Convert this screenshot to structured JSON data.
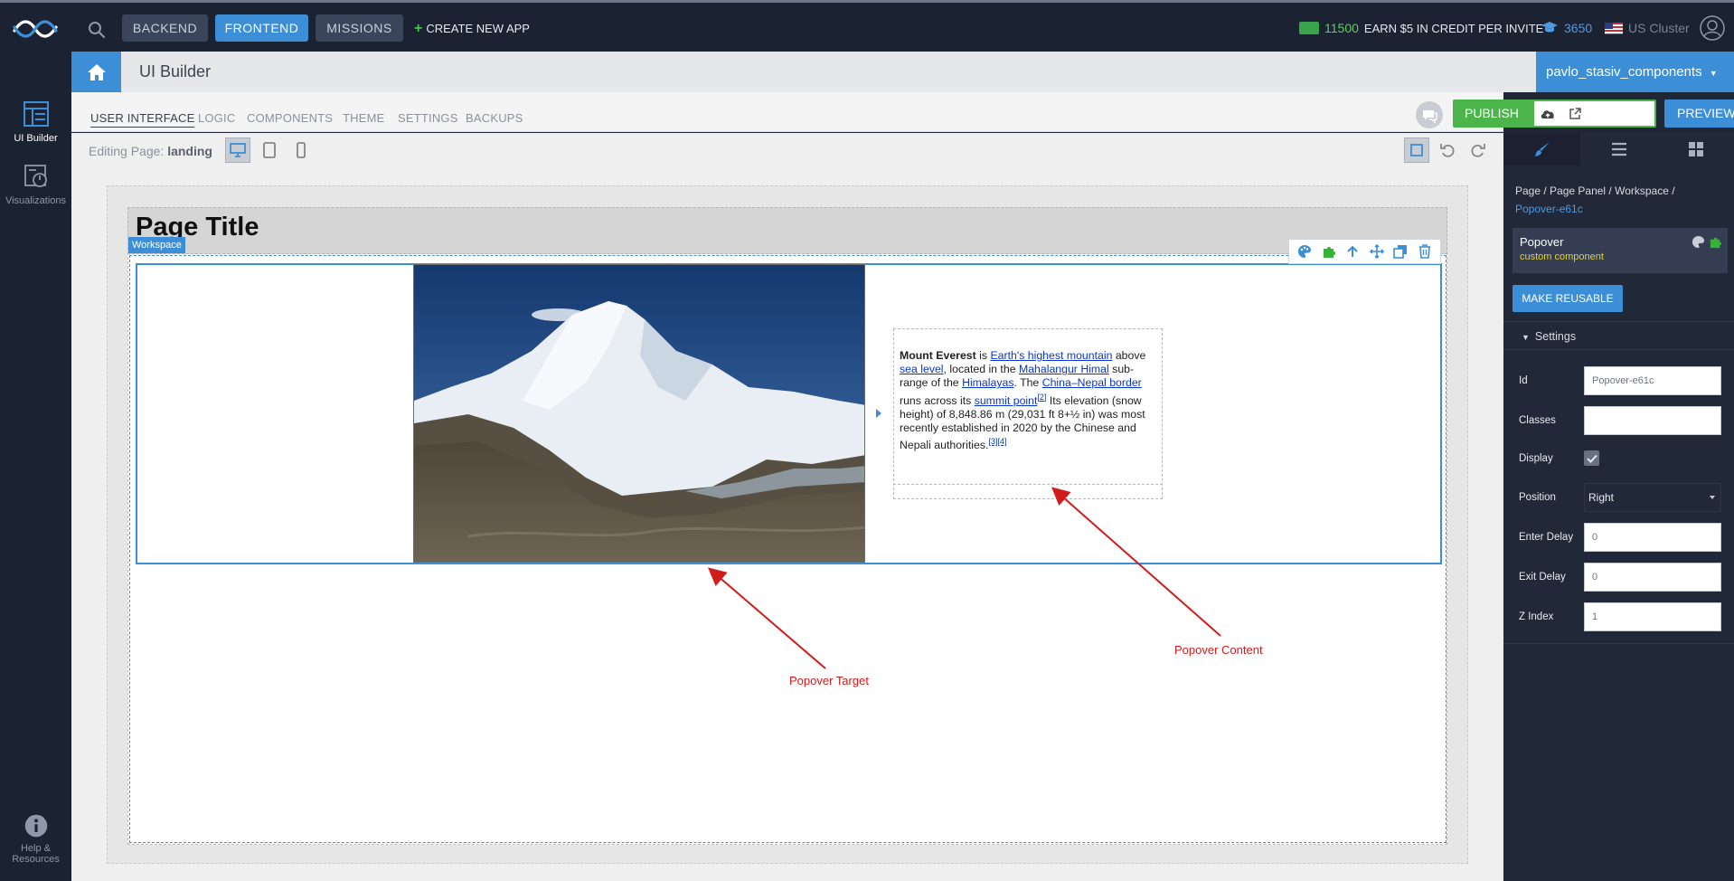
{
  "topbar": {
    "nav": [
      "BACKEND",
      "FRONTEND",
      "MISSIONS"
    ],
    "active_nav": "FRONTEND",
    "create_app": "CREATE NEW APP",
    "credits_value": "11500",
    "credits_text": "EARN $5 IN CREDIT PER INVITE",
    "education_value": "3650",
    "cluster": "US Cluster"
  },
  "left_sidebar": {
    "items": [
      {
        "label": "UI Builder",
        "icon": "ui-builder-icon"
      },
      {
        "label": "Visualizations",
        "icon": "visualizations-icon"
      }
    ],
    "help_line1": "Help &",
    "help_line2": "Resources"
  },
  "header": {
    "title": "UI Builder",
    "app_name": "pavlo_stasiv_components"
  },
  "subnav": {
    "tabs": [
      "USER INTERFACE",
      "LOGIC",
      "COMPONENTS",
      "THEME",
      "SETTINGS",
      "BACKUPS"
    ],
    "active_tab": "USER INTERFACE",
    "publish_label": "PUBLISH",
    "preview_label": "PREVIEW"
  },
  "editbar": {
    "editing_label": "Editing Page:",
    "page_name": "landing"
  },
  "canvas": {
    "page_title": "Page Title",
    "workspace_tag": "Workspace",
    "popover_content": {
      "bold": "Mount Everest",
      "t1": " is ",
      "l1": "Earth's highest mountain",
      "t2": " above ",
      "l2": "sea level",
      "t3": ", located in the ",
      "l3": "Mahalangur Himal",
      "t4": " sub-range of the ",
      "l4": "Himalayas",
      "t5": ". The ",
      "l5": "China–Nepal border",
      "t6": " runs across its ",
      "l6": "summit point",
      "s1": "[2]",
      "t7": " Its elevation (snow height) of 8,848.86 m (29,031 ft 8+½ in) was most recently established in 2020 by the Chinese and Nepali authorities.",
      "s2": "[3][4]"
    },
    "annotation_target": "Popover Target",
    "annotation_content": "Popover Content"
  },
  "right_panel": {
    "breadcrumb": "Page / Page Panel / Workspace /",
    "breadcrumb_current": "Popover-e61c",
    "component_name": "Popover",
    "component_type": "custom component",
    "make_reusable": "MAKE REUSABLE",
    "settings_label": "Settings",
    "fields": {
      "id_label": "Id",
      "id_value": "Popover-e61c",
      "classes_label": "Classes",
      "classes_value": "",
      "display_label": "Display",
      "display_checked": true,
      "position_label": "Position",
      "position_value": "Right",
      "enter_delay_label": "Enter Delay",
      "enter_delay_value": "0",
      "exit_delay_label": "Exit Delay",
      "exit_delay_value": "0",
      "zindex_label": "Z Index",
      "zindex_value": "1"
    }
  },
  "colors": {
    "accent": "#3c8fd6",
    "publish": "#4bb44b",
    "annotation": "#d21b1b"
  }
}
